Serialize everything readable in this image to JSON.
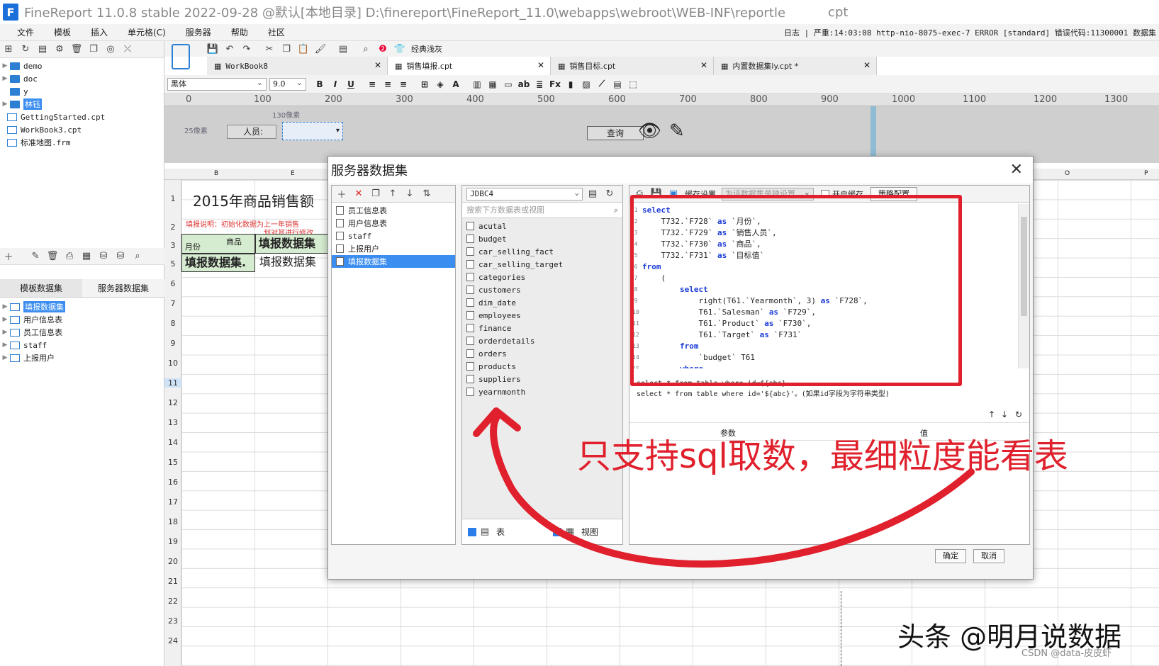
{
  "window": {
    "title": "FineReport 11.0.8 stable 2022-09-28 @默认[本地目录]    D:\\finereport\\FineReport_11.0\\webapps\\webroot\\WEB-INF\\reportle",
    "title_tail": "cpt"
  },
  "menu": [
    "文件",
    "模板",
    "插入",
    "单元格(C)",
    "服务器",
    "帮助",
    "社区"
  ],
  "log_line": "日志 | 严重:14:03:08 http-nio-8075-exec-7 ERROR [standard] 错误代码:11300001 数据集",
  "file_tree": [
    {
      "label": "demo",
      "type": "folder"
    },
    {
      "label": "doc",
      "type": "folder"
    },
    {
      "label": "y",
      "type": "folder"
    },
    {
      "label": "林钰",
      "type": "folder",
      "selected": true
    },
    {
      "label": "GettingStarted.cpt",
      "type": "file"
    },
    {
      "label": "WorkBook3.cpt",
      "type": "file"
    },
    {
      "label": "标准地图.frm",
      "type": "file"
    }
  ],
  "left_tabs": {
    "template_ds": "模板数据集",
    "server_ds": "服务器数据集"
  },
  "server_ds_tree": [
    "填报数据集",
    "用户信息表",
    "员工信息表",
    "staff",
    "上报用户"
  ],
  "toolbar": {
    "classic": "经典浅灰"
  },
  "tabs": [
    {
      "label": "WorkBook8"
    },
    {
      "label": "销售填报.cpt",
      "active": true
    },
    {
      "label": "销售目标.cpt"
    },
    {
      "label": "内置数据集ly.cpt *"
    }
  ],
  "format": {
    "font": "黑体",
    "size": "9.0"
  },
  "ruler_ticks": [
    "0",
    "100",
    "200",
    "300",
    "400",
    "500",
    "600",
    "700",
    "800",
    "900",
    "1000",
    "1100",
    "1200",
    "1300"
  ],
  "param_pane": {
    "width_hint": "130像素",
    "height_hint": "25像素",
    "label": "人员:",
    "query": "查询"
  },
  "sheet": {
    "cols": [
      "B",
      "E",
      "O",
      "P"
    ],
    "rows": [
      "1",
      "2",
      "3",
      "5",
      "6",
      "7",
      "8",
      "9",
      "10",
      "11",
      "12",
      "13",
      "14",
      "15",
      "16",
      "17",
      "18",
      "19",
      "20",
      "21",
      "22",
      "23",
      "24"
    ],
    "title": "2015年商品销售额",
    "note": "填报说明：初始化数据为上一年销售",
    "note2": "划对其进行修改",
    "hdr_product": "商品",
    "hdr_month": "月份",
    "hdr_fill": "填报数据集",
    "cell_a5": "填报数据集.",
    "cell_b5": "填报数据集"
  },
  "dialog": {
    "title": "服务器数据集",
    "datasets": [
      "员工信息表",
      "用户信息表",
      "staff",
      "上报用户",
      "填报数据集"
    ],
    "connection": "JDBC4",
    "search_placeholder": "搜索下方数据表或视图",
    "tables": [
      "acutal",
      "budget",
      "car_selling_fact",
      "car_selling_target",
      "categories",
      "customers",
      "dim_date",
      "employees",
      "finance",
      "orderdetails",
      "orders",
      "products",
      "suppliers",
      "yearnmonth"
    ],
    "cache_setting": "缓存设置",
    "cache_select": "为该数据集单独设置",
    "enable_cache": "开启缓存",
    "strategy": "策略配置",
    "sql_lines": [
      "select",
      "    T732.`F728` as `月份`,",
      "    T732.`F729` as `销售人员`,",
      "    T732.`F730` as `商品`,",
      "    T732.`F731` as `目标值`",
      "from",
      "    (",
      "        select",
      "            right(T61.`Yearmonth`, 3) as `F728`,",
      "            T61.`Salesman` as `F729`,",
      "            T61.`Product` as `F730`,",
      "            T61.`Target` as `F731`",
      "        from",
      "            `budget` T61",
      "        where"
    ],
    "hint1": "select * from table where id=${abc}。",
    "hint2": "select * from table where id='${abc}'。(如果id字段为字符串类型)",
    "param_col": "参数",
    "value_col": "值",
    "chk_table": "表",
    "chk_view": "视图",
    "ok": "确定",
    "cancel": "取消"
  },
  "annotation": "只支持sql取数，最细粒度能看表",
  "watermark": "头条 @明月说数据",
  "watermark2": "CSDN @data-皮皮虾",
  "colors": {
    "accent": "#3b8ef0",
    "annotation": "#e0202c"
  }
}
